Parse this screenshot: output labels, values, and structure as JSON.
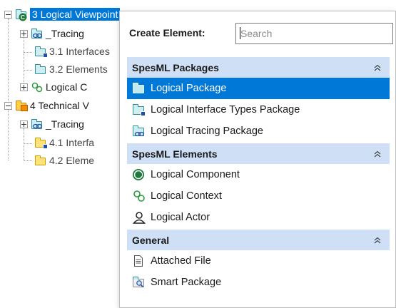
{
  "tree": {
    "items": [
      {
        "label": "3  Logical Viewpoint",
        "selected": true
      },
      {
        "label": "_Tracing"
      },
      {
        "label": "3.1 Interfaces"
      },
      {
        "label": "3.2 Elements"
      },
      {
        "label": "Logical C"
      },
      {
        "label": "4 Technical V"
      },
      {
        "label": "_Tracing"
      },
      {
        "label": "4.1 Interfa"
      },
      {
        "label": "4.2 Eleme"
      }
    ]
  },
  "popup": {
    "create_label": "Create Element:",
    "search_placeholder": "Search",
    "sections": [
      {
        "title": "SpesML Packages",
        "items": [
          {
            "label": "Logical Package",
            "icon": "folder-icon",
            "selected": true
          },
          {
            "label": "Logical Interface Types Package",
            "icon": "interface-package-icon"
          },
          {
            "label": "Logical Tracing Package",
            "icon": "tracing-package-icon"
          }
        ]
      },
      {
        "title": "SpesML Elements",
        "items": [
          {
            "label": "Logical Component",
            "icon": "component-icon"
          },
          {
            "label": "Logical Context",
            "icon": "context-icon"
          },
          {
            "label": "Logical Actor",
            "icon": "actor-icon"
          }
        ]
      },
      {
        "title": "General",
        "items": [
          {
            "label": "Attached File",
            "icon": "attached-file-icon"
          },
          {
            "label": "Smart Package",
            "icon": "smart-package-icon"
          }
        ]
      }
    ]
  },
  "colors": {
    "selection": "#0078d7",
    "section_header": "#cfe0f6",
    "component_green": "#1e7b3e",
    "folder_teal": "#2f8f98"
  }
}
